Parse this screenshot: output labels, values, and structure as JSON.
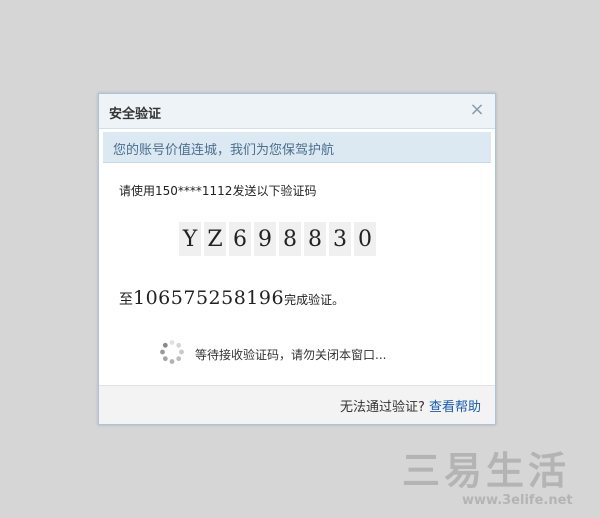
{
  "dialog": {
    "title": "安全验证",
    "close_symbol": "×",
    "banner": "您的账号价值连城，我们为您保驾护航",
    "instruction": "请使用150****1112发送以下验证码",
    "code_chars": [
      "Y",
      "Z",
      "6",
      "9",
      "8",
      "8",
      "3",
      "0"
    ],
    "send_prefix": "至",
    "send_number": "106575258196",
    "send_suffix": "完成验证。",
    "waiting_text": "等待接收验证码，请勿关闭本窗口...",
    "footer_question": "无法通过验证?",
    "footer_link": "查看帮助",
    "spinner_icon": "loading-spinner-icon"
  },
  "watermark": {
    "brand": "三易生活",
    "url": "www.3elife.net"
  },
  "colors": {
    "link": "#1a5ca8",
    "banner_text": "#4b6f8f",
    "border": "#a9c4dc"
  }
}
